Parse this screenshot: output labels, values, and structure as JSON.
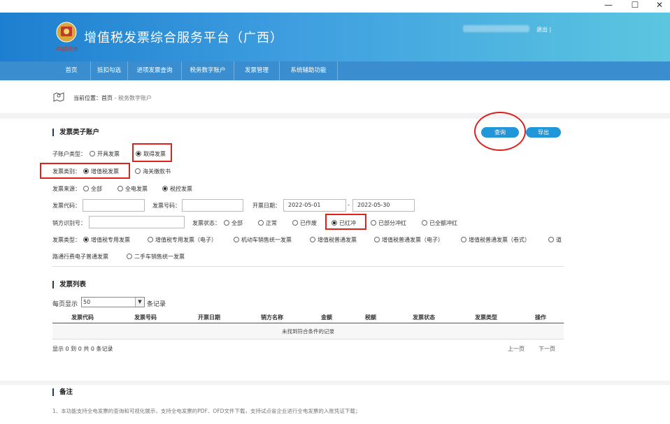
{
  "window": {
    "minimize": "—",
    "maximize": "☐",
    "close": "✕"
  },
  "header": {
    "logo_text": "中国税务",
    "title": "增值税发票综合服务平台（广西）",
    "logout": "退出 |"
  },
  "nav": [
    {
      "label": "首页",
      "width": 54
    },
    {
      "label": "抵扣勾选",
      "width": 52
    },
    {
      "label": "进项发票查询",
      "width": 76
    },
    {
      "label": "税务数字账户",
      "width": 74
    },
    {
      "label": "发票管理",
      "width": 64
    },
    {
      "label": "系统辅助功能",
      "width": 82
    }
  ],
  "breadcrumb": {
    "prefix": "当前位置：",
    "home": "首页",
    "sep": " - ",
    "current": "税务数字账户"
  },
  "section1": {
    "title": "发票类子账户",
    "query_btn": "查询",
    "export_btn": "导出"
  },
  "filters": {
    "subaccount_label": "子账户类型：",
    "subaccount_opts": [
      "开具发票",
      "取得发票"
    ],
    "category_label": "发票类别：",
    "category_opts": [
      "增值税发票",
      "海关缴款书"
    ],
    "source_label": "发票来源：",
    "source_opts": [
      "全部",
      "全电发票",
      "税控发票"
    ],
    "code_label": "发票代码：",
    "number_label": "发票号码：",
    "date_label": "开票日期：",
    "date_from": "2022-05-01",
    "date_sep": "-",
    "date_to": "2022-05-30",
    "seller_label": "销方识别号：",
    "status_label": "发票状态：",
    "status_opts": [
      "全部",
      "正常",
      "已作废",
      "已红冲",
      "已部分冲红",
      "已全额冲红"
    ],
    "type_label": "发票类型：",
    "type_opts": [
      "增值税专用发票",
      "增值税专用发票（电子）",
      "机动车销售统一发票",
      "增值税普通发票",
      "增值税普通发票（电子）",
      "增值税普通发票（卷式）",
      "道"
    ],
    "type_opts_row2": [
      "路通行费电子普通发票",
      "二手车销售统一发票"
    ]
  },
  "list": {
    "title": "发票列表",
    "per_page_prefix": "每页显示",
    "per_page": "50",
    "per_page_suffix": "条记录",
    "columns": [
      "发票代码",
      "发票号码",
      "开票日期",
      "销方名称",
      "金额",
      "税额",
      "发票状态",
      "发票类型",
      "操作"
    ],
    "empty": "未找到符合条件的记录",
    "summary": "显示 0 到 0 共 0 条记录",
    "prev": "上一页",
    "next": "下一页"
  },
  "notes": {
    "title": "备注",
    "line1": "1、本功能支持全电发票的查询和可视化展示，支持全电发票的PDF、OFD文件下载，支持试点省企业进行全电发票的入账凭证下载；"
  },
  "colors": {
    "header_left": "#1d7fcf",
    "header_right": "#5cc6e0",
    "nav": "#3a8ecf",
    "button": "#2196d9",
    "annotation": "#e0201c"
  }
}
